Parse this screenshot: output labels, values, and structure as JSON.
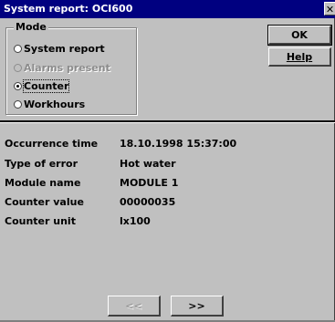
{
  "window": {
    "title": "System report: OCI600",
    "close_glyph": "✕"
  },
  "mode": {
    "legend": "Mode",
    "options": [
      {
        "label": "System report",
        "enabled": true,
        "selected": false
      },
      {
        "label": "Alarms present",
        "enabled": false,
        "selected": false
      },
      {
        "label": "Counter",
        "enabled": true,
        "selected": true
      },
      {
        "label": "Workhours",
        "enabled": true,
        "selected": false
      }
    ]
  },
  "buttons": {
    "ok": "OK",
    "help": "Help",
    "prev": "<<",
    "next": ">>"
  },
  "details": [
    {
      "label": "Occurrence time",
      "value": "18.10.1998 15:37:00"
    },
    {
      "label": "Type of error",
      "value": "Hot water"
    },
    {
      "label": "Module name",
      "value": "MODULE 1"
    },
    {
      "label": "Counter value",
      "value": "00000035"
    },
    {
      "label": "Counter unit",
      "value": "lx100"
    }
  ],
  "colors": {
    "titlebar": "#000080",
    "face": "#c0c0c0",
    "disabled_text": "#8c8c8c"
  }
}
